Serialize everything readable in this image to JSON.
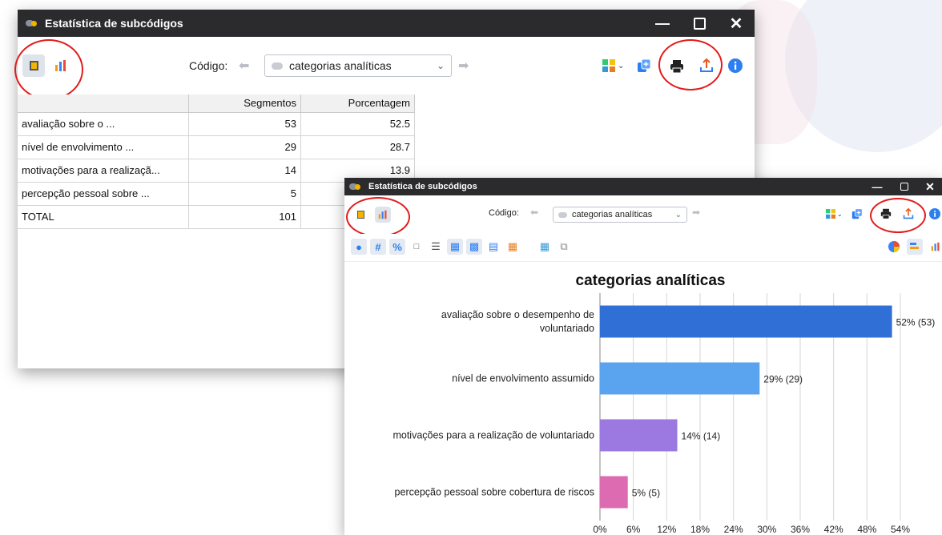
{
  "window1": {
    "title": "Estatística de subcódigos",
    "code_label": "Código:",
    "code_value": "categorias analíticas",
    "table": {
      "headers": [
        "",
        "Segmentos",
        "Porcentagem"
      ],
      "rows": [
        [
          "avaliação sobre o ...",
          "53",
          "52.5"
        ],
        [
          "nível de envolvimento ...",
          "29",
          "28.7"
        ],
        [
          "motivações para a realizaçã...",
          "14",
          "13.9"
        ],
        [
          "percepção pessoal sobre ...",
          "5",
          ""
        ],
        [
          "TOTAL",
          "101",
          ""
        ]
      ]
    }
  },
  "window2": {
    "title": "Estatística de subcódigos",
    "code_label": "Código:",
    "code_value": "categorias analíticas"
  },
  "colors": {
    "titlebar": "#2b2b2e",
    "highlight": "#e21b1b",
    "bar1": "#2f6fd6",
    "bar2": "#5aa3ee",
    "bar3": "#9b79e0",
    "bar4": "#dc6bb2"
  },
  "chart_data": {
    "type": "bar",
    "orientation": "horizontal",
    "title": "categorias analíticas",
    "categories": [
      "avaliação sobre o desempenho de voluntariado",
      "nível de envolvimento assumido",
      "motivações para a realização de voluntariado",
      "percepção pessoal sobre cobertura de riscos"
    ],
    "category_lines": [
      [
        "avaliação sobre o desempenho de",
        "voluntariado"
      ],
      [
        "nível de envolvimento assumido"
      ],
      [
        "motivações para a realização de voluntariado"
      ],
      [
        "percepção pessoal sobre cobertura de riscos"
      ]
    ],
    "values": [
      52.5,
      28.7,
      13.9,
      5
    ],
    "data_labels": [
      "52% (53)",
      "29% (29)",
      "14% (14)",
      "5% (5)"
    ],
    "xlim": [
      0,
      54
    ],
    "xticks": [
      "0%",
      "6%",
      "12%",
      "18%",
      "24%",
      "30%",
      "36%",
      "42%",
      "48%",
      "54%"
    ],
    "grid": true,
    "bar_colors": [
      "#2f6fd6",
      "#5aa3ee",
      "#9b79e0",
      "#dc6bb2"
    ]
  }
}
